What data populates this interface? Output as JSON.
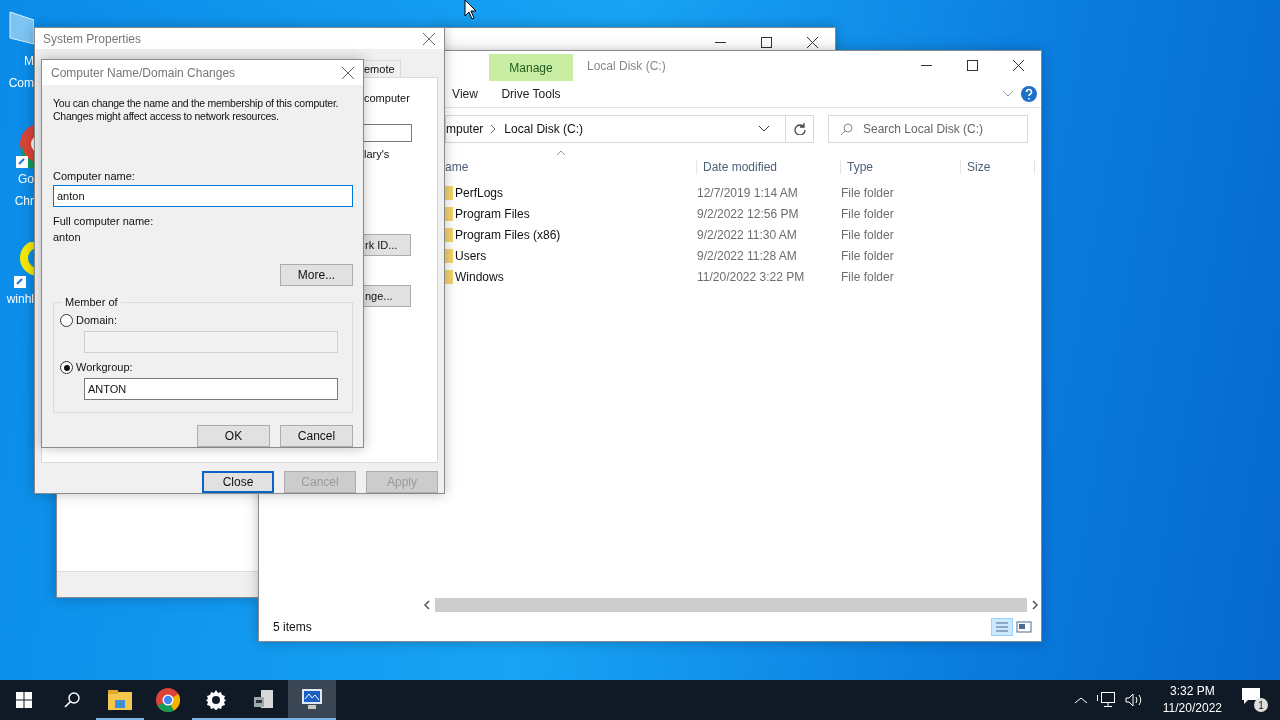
{
  "desktop_icons": [
    {
      "kind": "monitor",
      "lines": [
        "M",
        "Com"
      ]
    },
    {
      "kind": "chrome",
      "lines": [
        "Go",
        "Chr"
      ]
    },
    {
      "kind": "lifebuoy",
      "lines": [
        "winhl"
      ]
    }
  ],
  "system_properties": {
    "title": "System Properties",
    "tab": "emote",
    "fragments": [
      "computer",
      "lary's"
    ],
    "partial_buttons": [
      "rk ID...",
      "nge..."
    ],
    "buttons": [
      {
        "label": "Close",
        "default": true,
        "disabled": false
      },
      {
        "label": "Cancel",
        "default": false,
        "disabled": true
      },
      {
        "label": "Apply",
        "default": false,
        "disabled": true
      }
    ]
  },
  "dialog": {
    "title": "Computer Name/Domain Changes",
    "description": "You can change the name and the membership of this computer. Changes might affect access to network resources.",
    "computer_name_label": "Computer name:",
    "computer_name": "anton",
    "full_name_label": "Full computer name:",
    "full_name": "anton",
    "more_button": "More...",
    "group_title": "Member of",
    "options": [
      {
        "label": "Domain:",
        "selected": false
      },
      {
        "label": "Workgroup:",
        "selected": true,
        "value": "ANTON"
      }
    ],
    "buttons": [
      "OK",
      "Cancel"
    ]
  },
  "explorer": {
    "context_tab": "Manage",
    "title": "Local Disk (C:)",
    "ribbon_tabs": [
      "View",
      "Drive Tools"
    ],
    "address": [
      "mputer",
      "Local Disk (C:)"
    ],
    "search_placeholder": "Search Local Disk (C:)",
    "columns": [
      "ame",
      "Date modified",
      "Type",
      "Size"
    ],
    "rows": [
      {
        "name": "PerfLogs",
        "date": "12/7/2019 1:14 AM",
        "type": "File folder"
      },
      {
        "name": "Program Files",
        "date": "9/2/2022 12:56 PM",
        "type": "File folder"
      },
      {
        "name": "Program Files (x86)",
        "date": "9/2/2022 11:30 AM",
        "type": "File folder"
      },
      {
        "name": "Users",
        "date": "9/2/2022 11:28 AM",
        "type": "File folder"
      },
      {
        "name": "Windows",
        "date": "11/20/2022 3:22 PM",
        "type": "File folder"
      }
    ],
    "status": "5 items"
  },
  "taskbar": {
    "apps": [
      {
        "kind": "explorer",
        "running": true,
        "active": false
      },
      {
        "kind": "chrome",
        "running": false,
        "active": false
      },
      {
        "kind": "settings",
        "running": true,
        "active": false
      },
      {
        "kind": "server",
        "running": true,
        "active": false
      },
      {
        "kind": "monitor",
        "running": true,
        "active": true
      }
    ],
    "time": "3:32 PM",
    "date": "11/20/2022",
    "notifications": "1"
  }
}
